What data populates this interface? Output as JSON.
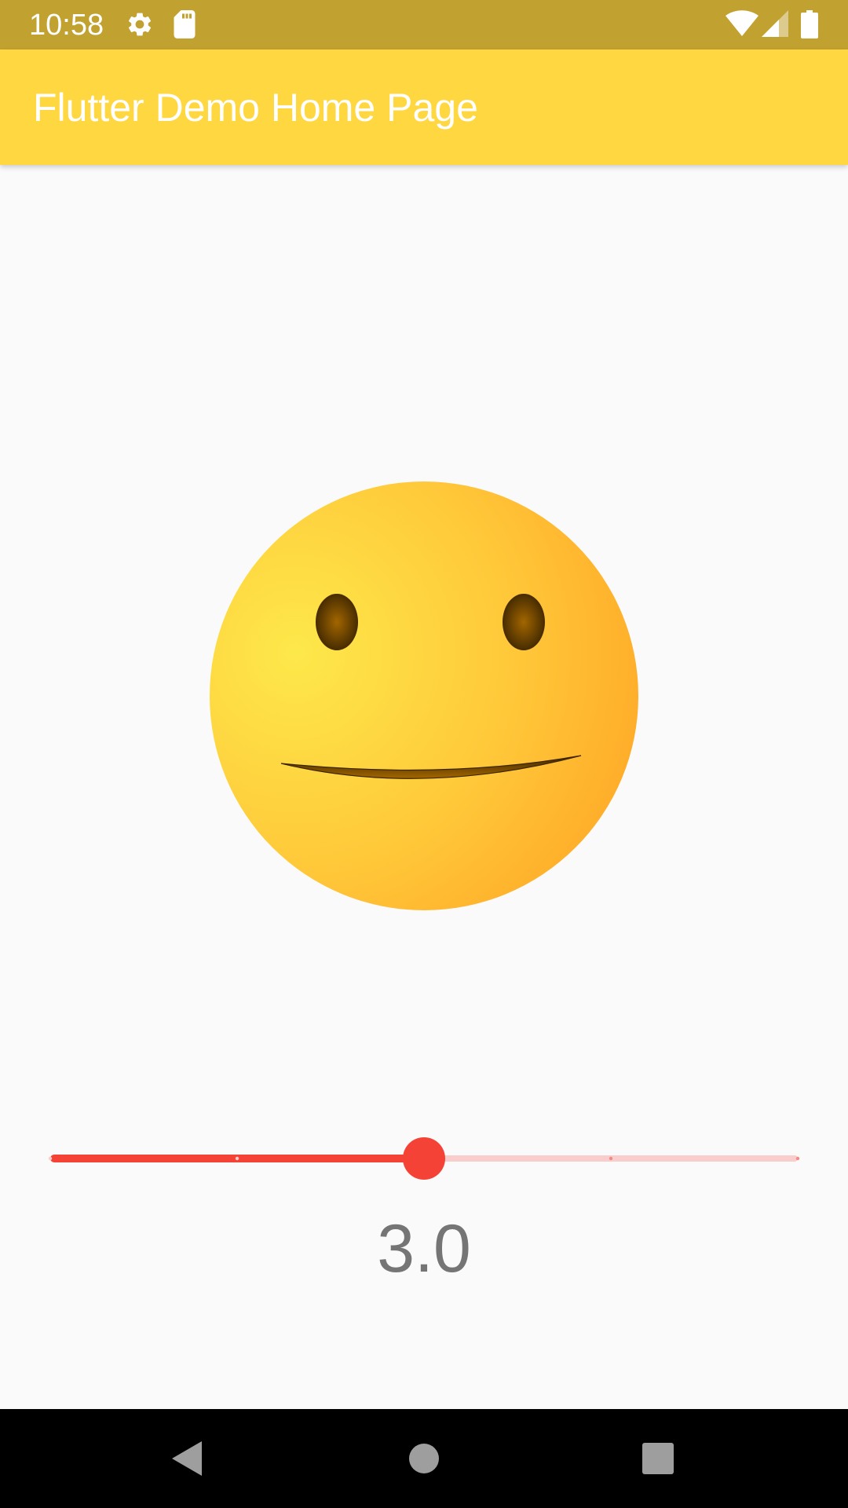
{
  "status_bar": {
    "time": "10:58",
    "left_icons": [
      "settings-gear-icon",
      "sd-card-icon"
    ],
    "right_icons": [
      "wifi-icon",
      "cellular-signal-icon",
      "battery-icon"
    ],
    "color": "#c1a130"
  },
  "app_bar": {
    "title": "Flutter Demo Home Page",
    "color": "#ffd740"
  },
  "face": {
    "description_icon": "smiley-face-icon",
    "colors": [
      "#fde84a",
      "#ffa726"
    ]
  },
  "slider": {
    "min": 1,
    "max": 5,
    "divisions": 4,
    "value": 3.0,
    "active_color": "#f44336",
    "inactive_color": "#f8cdcb"
  },
  "value_label": "3.0",
  "nav_bar": {
    "buttons": [
      "back-icon",
      "home-icon",
      "recents-icon"
    ]
  }
}
